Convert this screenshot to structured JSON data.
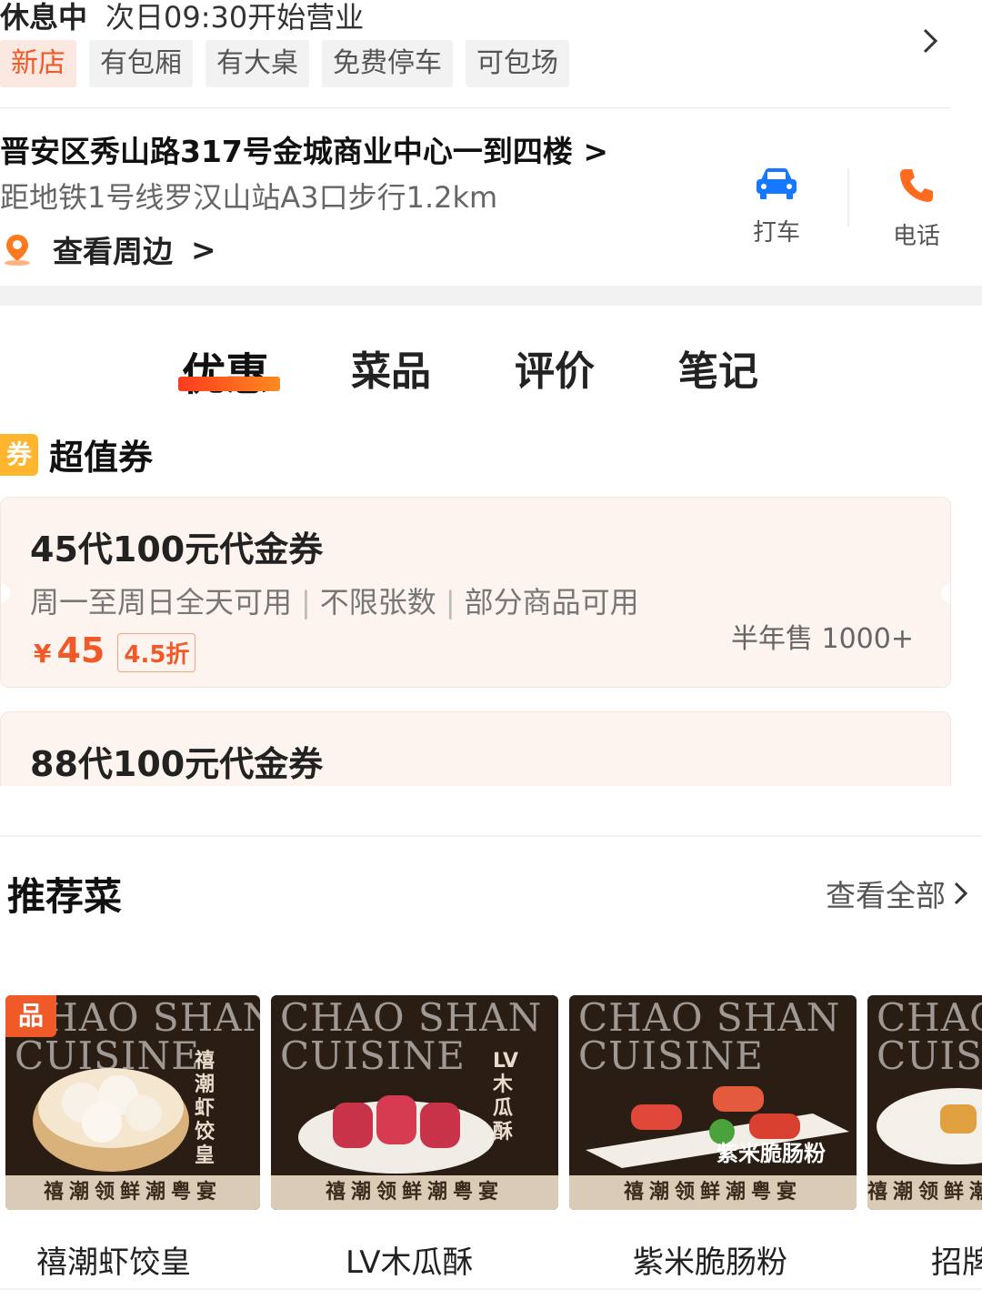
{
  "status": {
    "state": "休息中",
    "hours": "次日09:30开始营业"
  },
  "tags": [
    "新店",
    "有包厢",
    "有大桌",
    "免费停车",
    "可包场"
  ],
  "address": {
    "line": "晋安区秀山路317号金城商业中心一到四楼",
    "subway": "距地铁1号线罗汉山站A3口步行1.2km",
    "nearby": "查看周边"
  },
  "actions": {
    "taxi": "打车",
    "phone": "电话"
  },
  "tabs": [
    "优惠",
    "菜品",
    "评价",
    "笔记"
  ],
  "coupons": {
    "badge": "券",
    "title": "超值券",
    "items": [
      {
        "title": "45代100元代金券",
        "meta": [
          "周一至周日全天可用",
          "不限张数",
          "部分商品可用"
        ],
        "currency": "¥",
        "price": "45",
        "discount": "4.5折",
        "sold": "半年售 1000+"
      },
      {
        "title": "88代100元代金券"
      }
    ]
  },
  "recommend": {
    "title": "推荐菜",
    "view_all": "查看全部",
    "signature_badge": "品",
    "brand_en": "CHAO SHAN\nCUISINE",
    "brand_cn": "禧潮领鲜潮粤宴",
    "dishes": [
      {
        "name": "禧潮虾饺皇",
        "vertical": "禧潮虾饺皇"
      },
      {
        "name": "LV木瓜酥",
        "vertical": "LV木瓜酥"
      },
      {
        "name": "紫米脆肠粉",
        "overlay": "紫米脆肠粉"
      },
      {
        "name": "招牌"
      }
    ]
  },
  "colors": {
    "accent": "#f05a28",
    "taxi": "#1677ff",
    "tab_underline": "#ff3b1f",
    "coupon_badge": "#ffb52e"
  }
}
